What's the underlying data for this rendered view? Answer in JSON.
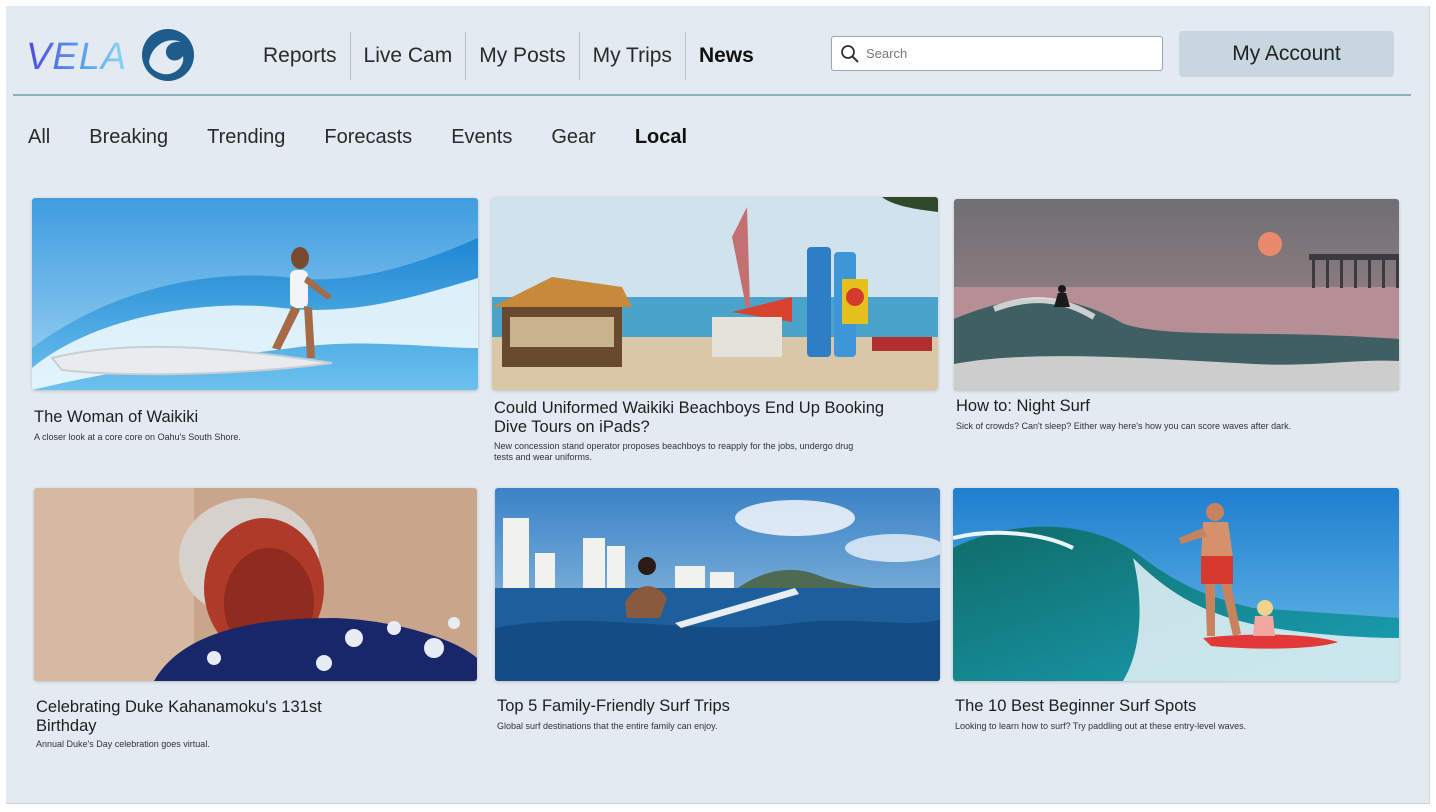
{
  "brand": {
    "name": "VELA",
    "logo_icon": "wave-logo-icon"
  },
  "nav": {
    "items": [
      {
        "label": "Reports",
        "active": false
      },
      {
        "label": "Live Cam",
        "active": false
      },
      {
        "label": "My Posts",
        "active": false
      },
      {
        "label": "My Trips",
        "active": false
      },
      {
        "label": "News",
        "active": true
      }
    ]
  },
  "search": {
    "placeholder": "Search",
    "value": "",
    "icon": "search-icon"
  },
  "account": {
    "label": "My Account"
  },
  "tabs": [
    {
      "label": "All",
      "active": false
    },
    {
      "label": "Breaking",
      "active": false
    },
    {
      "label": "Trending",
      "active": false
    },
    {
      "label": "Forecasts",
      "active": false
    },
    {
      "label": "Events",
      "active": false
    },
    {
      "label": "Gear",
      "active": false
    },
    {
      "label": "Local",
      "active": true
    }
  ],
  "articles": [
    {
      "title": "The Woman of Waikiki",
      "subtitle": "A closer look at a core core on Oahu's South Shore.",
      "image": "surfer-woman-photo"
    },
    {
      "title": "Could Uniformed Waikiki Beachboys End Up Booking Dive Tours on iPads?",
      "subtitle": "New concession stand operator proposes beachboys to reapply for the jobs, undergo drug tests and wear uniforms.",
      "image": "beach-stand-photo"
    },
    {
      "title": "How to: Night Surf",
      "subtitle": "Sick of crowds? Can't sleep? Either way here's how you can score waves after dark.",
      "image": "night-surf-photo"
    },
    {
      "title": "Celebrating Duke Kahanamoku's 131st Birthday",
      "subtitle": "Annual Duke's Day celebration goes virtual.",
      "image": "duke-portrait-photo"
    },
    {
      "title": "Top 5 Family-Friendly Surf Trips",
      "subtitle": "Global surf destinations that the entire family can enjoy.",
      "image": "family-surf-photo"
    },
    {
      "title": "The 10 Best Beginner Surf Spots",
      "subtitle": "Looking to learn how to surf? Try paddling out at these entry-level waves.",
      "image": "beginner-surf-photo"
    }
  ],
  "colors": {
    "background": "#e3eaf1",
    "accent": "#1f5c8e",
    "account_button": "#c7d6df",
    "rule": "#8fb1bd"
  }
}
